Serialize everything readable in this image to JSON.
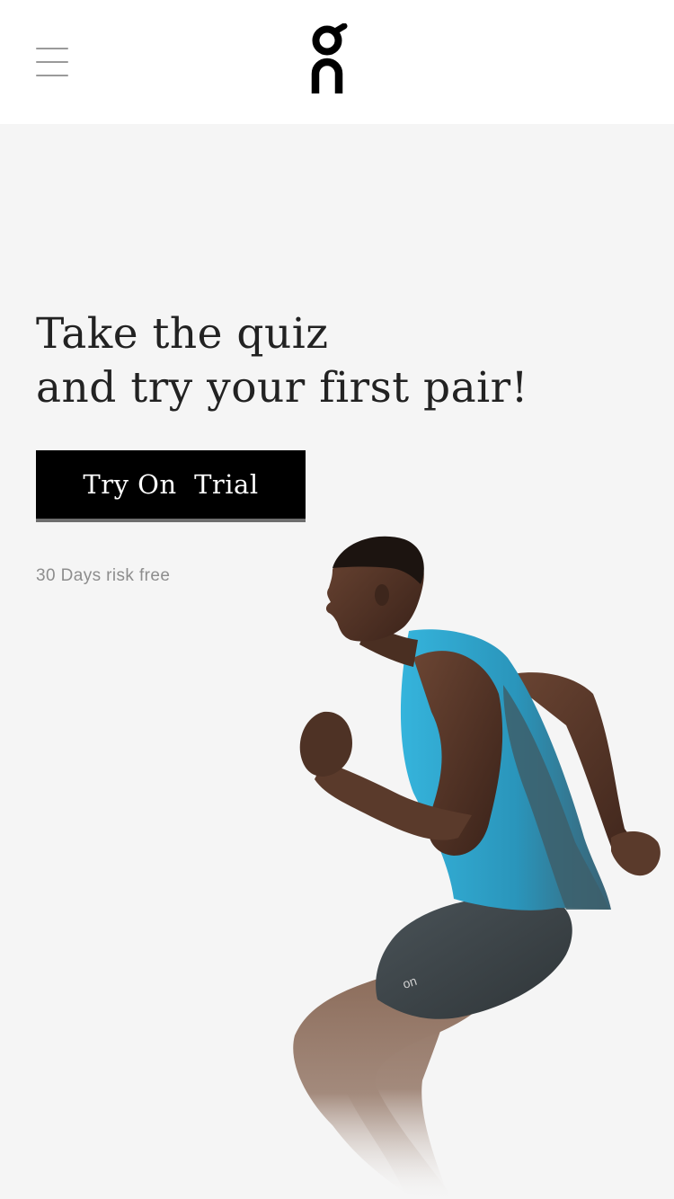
{
  "header": {
    "menu_icon": "hamburger-menu-icon",
    "logo_name": "On logo"
  },
  "hero": {
    "headline_line1": "Take the quiz",
    "headline_line2": "and try your first pair!",
    "cta_label": "Try On  Trial",
    "subtext": "30 Days risk free",
    "image": "runner-photo"
  },
  "colors": {
    "page_bg": "#f5f5f5",
    "header_bg": "#ffffff",
    "cta_bg": "#000000",
    "cta_text": "#ffffff",
    "heading_text": "#222222",
    "muted_text": "#8d8d8d",
    "tank_top": "#2aa6cf"
  }
}
